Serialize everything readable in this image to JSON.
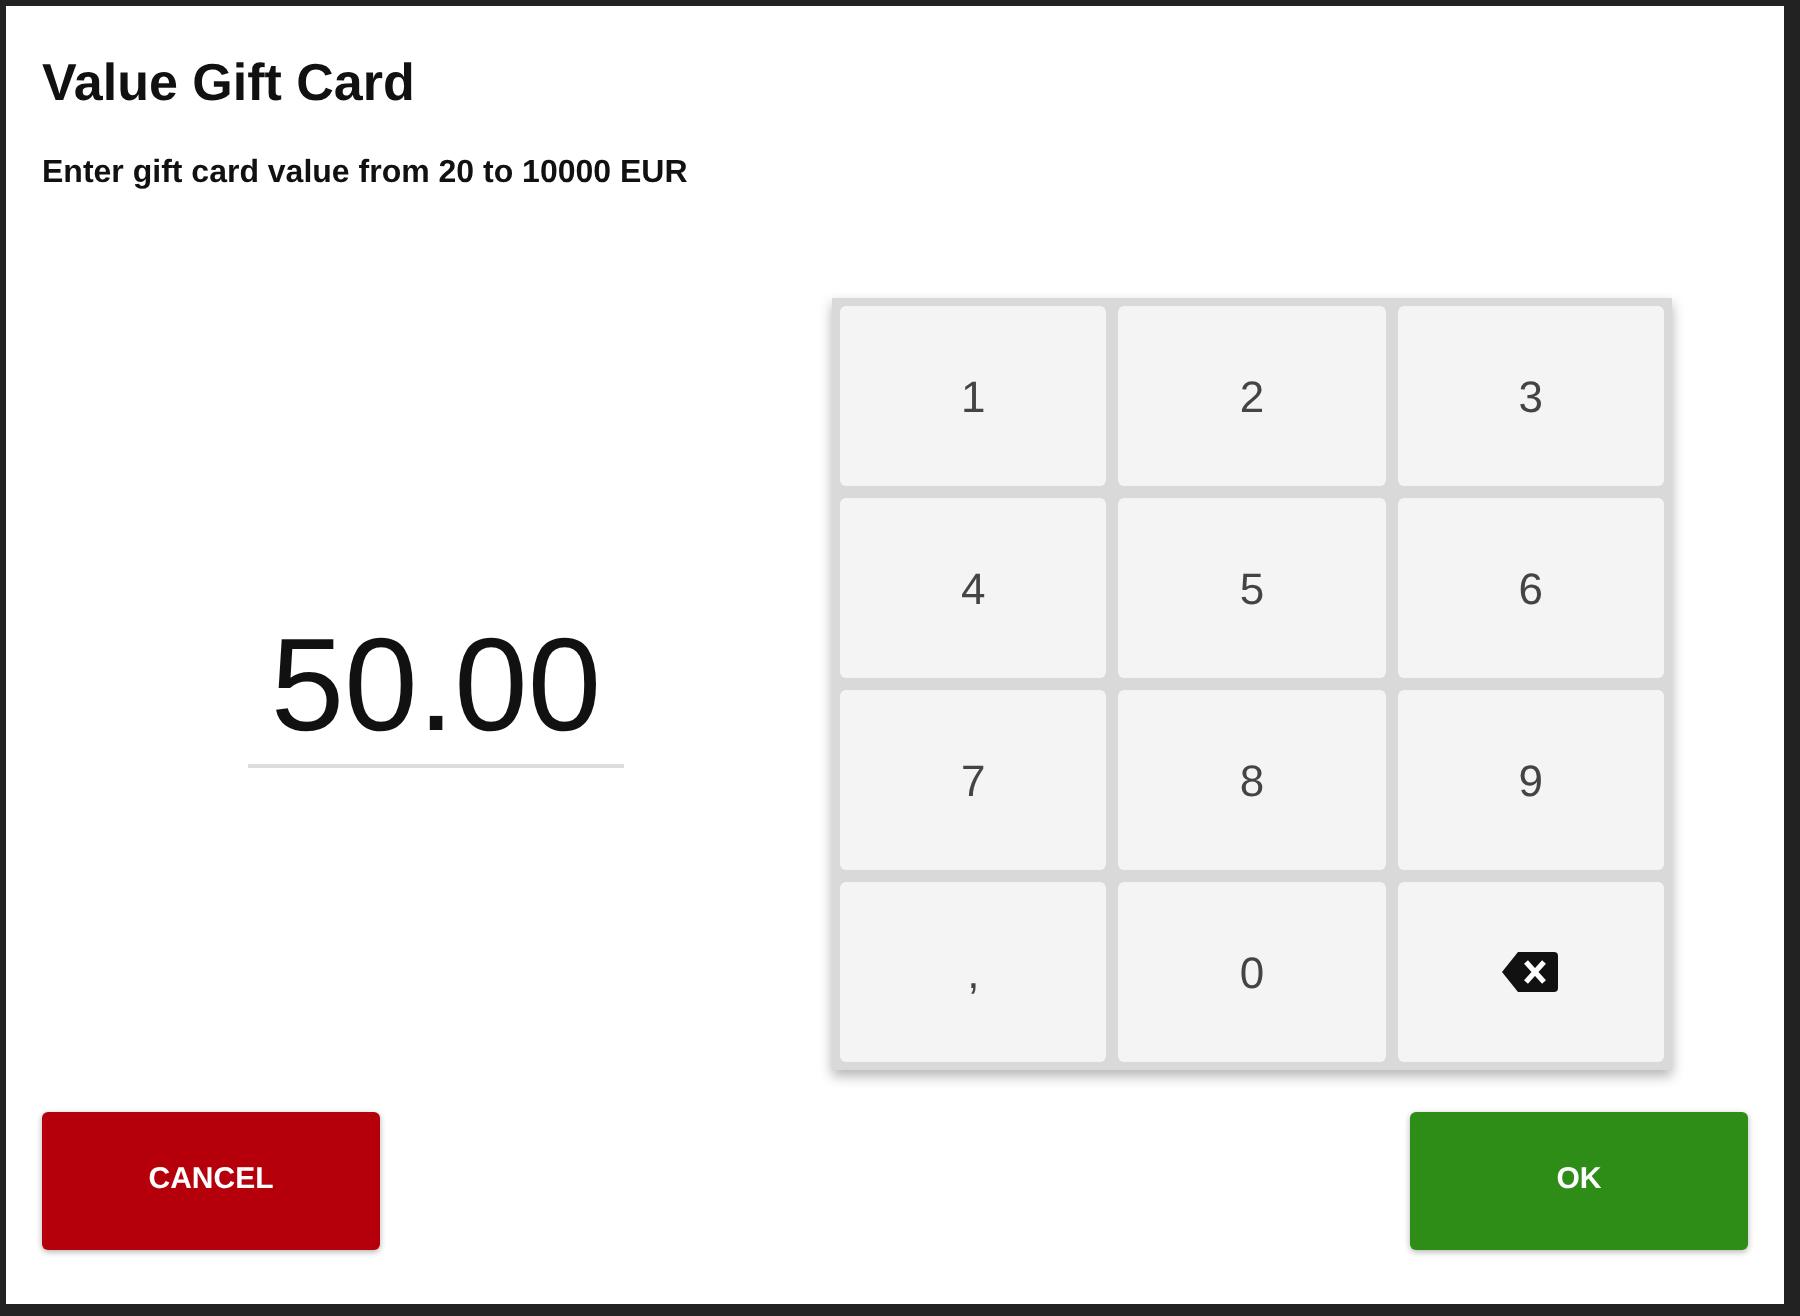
{
  "title": "Value Gift Card",
  "instruction": "Enter gift card value from 20 to 10000 EUR",
  "amount": {
    "value": "50.00"
  },
  "keypad": [
    {
      "kind": "digit",
      "label": "1"
    },
    {
      "kind": "digit",
      "label": "2"
    },
    {
      "kind": "digit",
      "label": "3"
    },
    {
      "kind": "digit",
      "label": "4"
    },
    {
      "kind": "digit",
      "label": "5"
    },
    {
      "kind": "digit",
      "label": "6"
    },
    {
      "kind": "digit",
      "label": "7"
    },
    {
      "kind": "digit",
      "label": "8"
    },
    {
      "kind": "digit",
      "label": "9"
    },
    {
      "kind": "digit",
      "label": ","
    },
    {
      "kind": "digit",
      "label": "0"
    },
    {
      "kind": "backspace"
    }
  ],
  "buttons": [
    {
      "kind": "cancel",
      "label": "CANCEL"
    },
    {
      "kind": "ok",
      "label": "OK"
    }
  ]
}
